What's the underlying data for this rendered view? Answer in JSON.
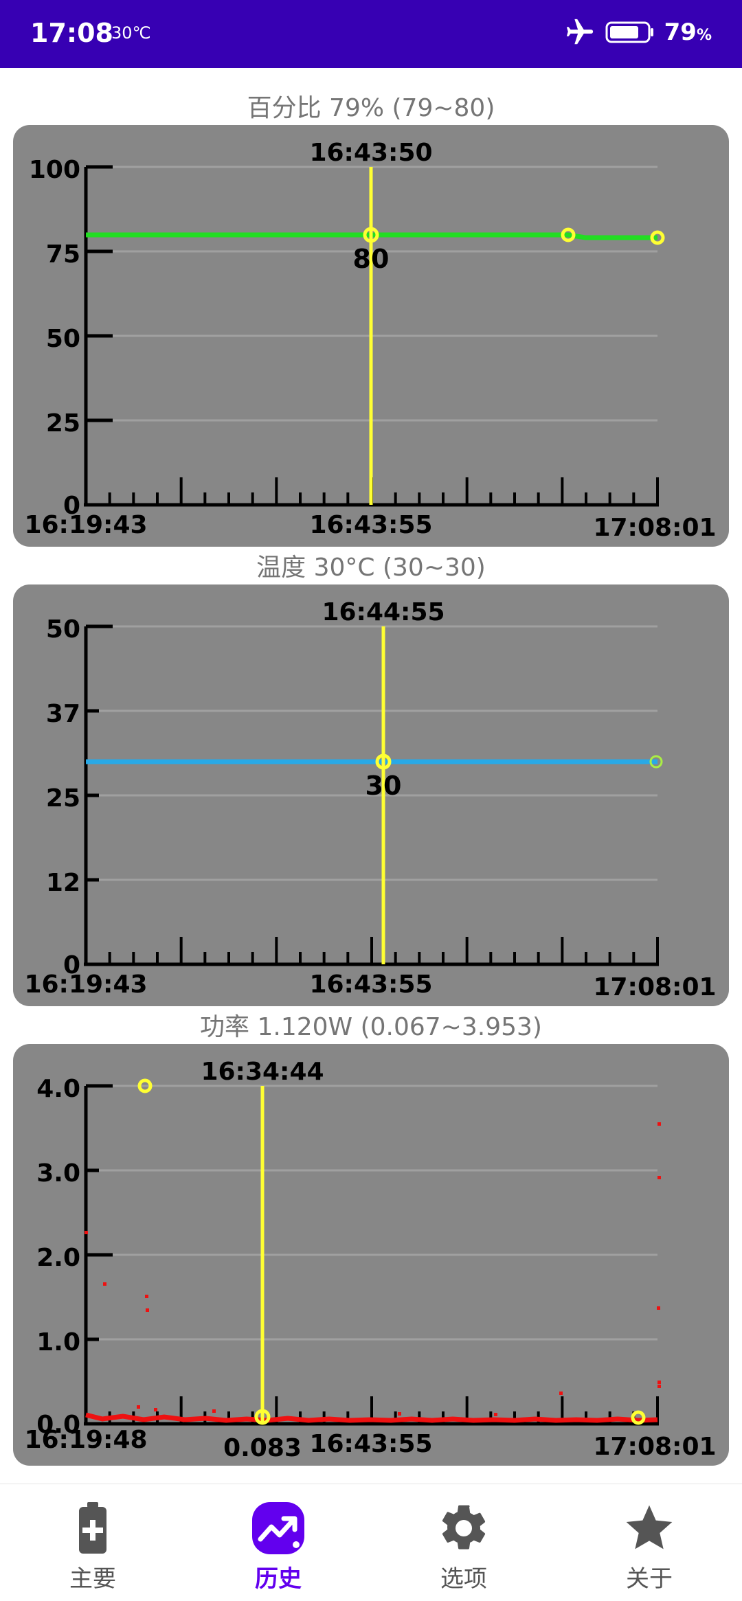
{
  "status_bar": {
    "time": "17:08",
    "temperature": "30℃",
    "battery_percent": "79",
    "battery_unit": "%",
    "airplane_mode": true
  },
  "charts": [
    {
      "title": "百分比 79% (79~80)",
      "cursor_time": "16:43:50",
      "cursor_value": "80",
      "y_ticks": [
        "100",
        "75",
        "50",
        "25",
        "0"
      ],
      "x_labels": {
        "start": "16:19:43",
        "mid": "16:43:55",
        "end": "17:08:01"
      },
      "line_color": "#22dd22"
    },
    {
      "title": "温度 30°C (30~30)",
      "cursor_time": "16:44:55",
      "cursor_value": "30",
      "y_ticks": [
        "50",
        "37",
        "25",
        "12",
        "0"
      ],
      "x_labels": {
        "start": "16:19:43",
        "mid": "16:43:55",
        "end": "17:08:01"
      },
      "line_color": "#29a9e6"
    },
    {
      "title": "功率 1.120W (0.067~3.953)",
      "cursor_time": "16:34:44",
      "cursor_value": "0.083",
      "y_ticks": [
        "4.0",
        "3.0",
        "2.0",
        "1.0",
        "0.0"
      ],
      "x_labels": {
        "start": "16:19:48",
        "mid": "16:43:55",
        "end": "17:08:01"
      },
      "line_color": "#ee1111"
    }
  ],
  "chart_data": [
    {
      "type": "line",
      "title": "百分比 79% (79~80)",
      "x": [
        "16:19:43",
        "16:43:50",
        "16:57:00",
        "17:08:01"
      ],
      "series": [
        {
          "values": [
            80,
            80,
            80,
            79
          ]
        }
      ],
      "ylim": [
        0,
        100
      ],
      "grid": true
    },
    {
      "type": "line",
      "title": "温度 30°C (30~30)",
      "x": [
        "16:19:43",
        "16:44:55",
        "17:08:01"
      ],
      "series": [
        {
          "values": [
            30,
            30,
            30
          ]
        }
      ],
      "ylim": [
        0,
        50
      ],
      "grid": true
    },
    {
      "type": "scatter",
      "title": "功率 1.120W (0.067~3.953)",
      "x": [
        "16:19:48",
        "16:20:30",
        "16:23:00",
        "16:26:30",
        "16:26:40",
        "16:34:44",
        "17:07:00",
        "17:07:05",
        "17:07:10",
        "17:07:20",
        "17:07:30",
        "17:08:01"
      ],
      "series": [
        {
          "values": [
            2.25,
            0.15,
            1.6,
            1.5,
            1.35,
            0.083,
            3.53,
            2.9,
            1.3,
            0.5,
            0.45,
            0.1
          ]
        }
      ],
      "ylim": [
        0,
        4.0
      ],
      "grid": true
    }
  ],
  "bottom_nav": {
    "items": [
      {
        "label": "主要",
        "icon": "battery-icon"
      },
      {
        "label": "历史",
        "icon": "trending-up-icon"
      },
      {
        "label": "选项",
        "icon": "gear-icon"
      },
      {
        "label": "关于",
        "icon": "star-icon"
      }
    ],
    "active": 1,
    "accent_color": "#6200ee",
    "inactive_color": "#555555"
  }
}
